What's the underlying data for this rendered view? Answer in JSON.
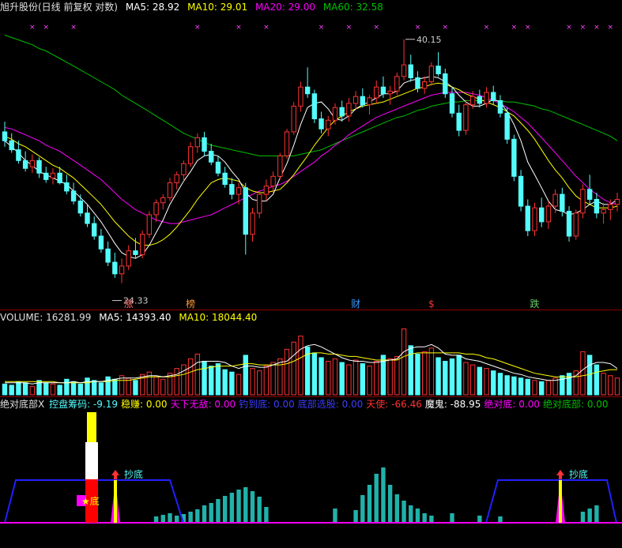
{
  "colors": {
    "up": "#ff3232",
    "down": "#54fcfc",
    "ma5": "#ffffff",
    "ma10": "#ffff00",
    "ma20": "#ff00ff",
    "ma60": "#00c000",
    "bg": "#000000"
  },
  "price_panel": {
    "title": "旭升股份(日线 前复权 对数)",
    "ma5": "MA5: 28.92",
    "ma10": "MA10: 29.01",
    "ma20": "MA20: 29.00",
    "ma60": "MA60: 32.58",
    "high_label": "40.15",
    "low_label": "24.33",
    "markers": [
      "涨",
      "榜",
      "财",
      "$",
      "跌"
    ]
  },
  "volume_panel": {
    "vol": "VOLUME: 16281.99",
    "ma5": "MA5: 14393.40",
    "ma10": "MA10: 18044.40"
  },
  "indicator_panel": {
    "name": "绝对底部X",
    "fields": [
      {
        "label": "控盘筹码:",
        "value": "-9.19",
        "color": "#54fcfc"
      },
      {
        "label": "稳赚:",
        "value": "0.00",
        "color": "#ffff00"
      },
      {
        "label": "天下无敌:",
        "value": "0.00",
        "color": "#ff00ff"
      },
      {
        "label": "钓到底:",
        "value": "0.00",
        "color": "#3c3cff"
      },
      {
        "label": "底部选股:",
        "value": "0.00",
        "color": "#3c3cff"
      },
      {
        "label": "天使:",
        "value": "-66.46",
        "color": "#ff3232"
      },
      {
        "label": "魔鬼:",
        "value": "-88.95",
        "color": "#ffffff"
      },
      {
        "label": "绝对底:",
        "value": "0.00",
        "color": "#ff00ff"
      },
      {
        "label": "绝对底部:",
        "value": "0.00",
        "color": "#00c000"
      }
    ],
    "signal_label": "抄底",
    "star_label": "★底"
  },
  "chart_data": {
    "type": "candlestick",
    "scale": "log",
    "ylim": [
      23.5,
      42.0
    ],
    "highlights": {
      "high": 40.15,
      "low": 24.33
    },
    "candles": [
      [
        33.2,
        33.9,
        32.2,
        32.6
      ],
      [
        32.6,
        33.1,
        31.8,
        32.0
      ],
      [
        32.0,
        32.6,
        31.1,
        31.3
      ],
      [
        31.3,
        31.9,
        30.6,
        30.8
      ],
      [
        30.9,
        31.7,
        30.5,
        31.3
      ],
      [
        31.3,
        31.5,
        30.2,
        30.5
      ],
      [
        30.5,
        30.9,
        29.9,
        30.1
      ],
      [
        30.2,
        30.8,
        29.8,
        30.5
      ],
      [
        30.5,
        30.9,
        29.8,
        29.9
      ],
      [
        29.9,
        30.4,
        29.2,
        29.4
      ],
      [
        29.4,
        29.9,
        28.6,
        28.8
      ],
      [
        28.8,
        29.2,
        27.9,
        28.1
      ],
      [
        28.1,
        28.6,
        27.3,
        27.5
      ],
      [
        27.5,
        27.9,
        26.6,
        26.8
      ],
      [
        26.8,
        27.2,
        25.9,
        26.1
      ],
      [
        26.1,
        26.5,
        25.2,
        25.4
      ],
      [
        25.4,
        25.9,
        24.6,
        24.8
      ],
      [
        24.8,
        25.6,
        24.33,
        25.2
      ],
      [
        25.2,
        26.3,
        25.0,
        26.0
      ],
      [
        26.0,
        26.7,
        25.6,
        25.8
      ],
      [
        25.8,
        27.1,
        25.6,
        26.9
      ],
      [
        26.9,
        28.2,
        26.7,
        28.0
      ],
      [
        28.0,
        28.9,
        27.6,
        28.7
      ],
      [
        28.7,
        29.2,
        28.3,
        29.0
      ],
      [
        29.0,
        30.2,
        28.8,
        29.9
      ],
      [
        29.9,
        30.6,
        29.5,
        30.4
      ],
      [
        30.4,
        31.3,
        30.0,
        31.1
      ],
      [
        31.1,
        32.5,
        30.9,
        32.2
      ],
      [
        32.2,
        33.1,
        31.8,
        32.8
      ],
      [
        32.8,
        33.2,
        31.6,
        31.9
      ],
      [
        31.9,
        32.4,
        31.0,
        31.2
      ],
      [
        31.2,
        31.6,
        30.3,
        30.5
      ],
      [
        30.5,
        30.9,
        29.6,
        29.8
      ],
      [
        29.8,
        30.2,
        28.9,
        29.2
      ],
      [
        29.2,
        29.9,
        28.6,
        29.6
      ],
      [
        29.6,
        29.9,
        25.8,
        26.9
      ],
      [
        26.9,
        28.4,
        26.5,
        28.1
      ],
      [
        28.1,
        29.4,
        27.8,
        29.2
      ],
      [
        29.2,
        30.1,
        28.8,
        29.7
      ],
      [
        29.7,
        30.6,
        29.3,
        30.3
      ],
      [
        30.3,
        31.8,
        30.1,
        31.6
      ],
      [
        31.6,
        33.4,
        31.4,
        33.2
      ],
      [
        33.2,
        35.3,
        33.0,
        35.0
      ],
      [
        35.0,
        36.8,
        34.6,
        36.4
      ],
      [
        36.4,
        37.9,
        35.6,
        35.9
      ],
      [
        35.9,
        36.2,
        33.8,
        34.1
      ],
      [
        34.1,
        34.6,
        33.1,
        33.4
      ],
      [
        33.4,
        34.3,
        32.9,
        34.0
      ],
      [
        34.0,
        35.2,
        33.7,
        34.9
      ],
      [
        34.9,
        35.4,
        33.9,
        34.3
      ],
      [
        34.3,
        35.6,
        33.9,
        35.2
      ],
      [
        35.2,
        36.1,
        34.8,
        35.7
      ],
      [
        35.7,
        36.3,
        34.9,
        35.1
      ],
      [
        35.1,
        35.8,
        34.4,
        35.6
      ],
      [
        35.6,
        36.9,
        35.2,
        36.4
      ],
      [
        36.4,
        37.2,
        35.6,
        35.9
      ],
      [
        35.9,
        36.5,
        35.1,
        36.1
      ],
      [
        36.1,
        37.5,
        35.8,
        37.2
      ],
      [
        37.2,
        40.15,
        36.9,
        38.1
      ],
      [
        38.1,
        38.9,
        36.8,
        37.1
      ],
      [
        37.1,
        37.6,
        36.0,
        36.3
      ],
      [
        36.3,
        37.2,
        35.9,
        36.8
      ],
      [
        36.8,
        38.3,
        36.5,
        38.0
      ],
      [
        38.0,
        39.1,
        37.2,
        37.4
      ],
      [
        37.4,
        37.8,
        35.6,
        35.9
      ],
      [
        35.9,
        36.4,
        34.2,
        34.5
      ],
      [
        34.5,
        35.1,
        32.9,
        33.3
      ],
      [
        33.3,
        35.4,
        33.0,
        35.1
      ],
      [
        35.1,
        36.1,
        34.8,
        35.7
      ],
      [
        35.7,
        36.2,
        34.9,
        35.2
      ],
      [
        35.2,
        36.4,
        34.9,
        36.0
      ],
      [
        36.0,
        36.5,
        35.1,
        35.4
      ],
      [
        35.4,
        35.8,
        34.2,
        34.5
      ],
      [
        34.5,
        34.9,
        32.4,
        32.7
      ],
      [
        32.7,
        33.0,
        30.0,
        30.3
      ],
      [
        30.3,
        30.7,
        28.2,
        28.5
      ],
      [
        28.5,
        28.9,
        26.8,
        27.1
      ],
      [
        27.1,
        28.7,
        26.8,
        28.4
      ],
      [
        28.4,
        29.0,
        27.3,
        27.6
      ],
      [
        27.6,
        28.8,
        27.2,
        28.5
      ],
      [
        28.5,
        29.5,
        28.1,
        29.2
      ],
      [
        29.2,
        29.6,
        27.9,
        28.2
      ],
      [
        28.2,
        28.5,
        26.5,
        26.8
      ],
      [
        26.8,
        28.3,
        26.6,
        28.1
      ],
      [
        28.1,
        29.8,
        27.8,
        29.5
      ],
      [
        29.5,
        30.4,
        28.6,
        28.9
      ],
      [
        28.9,
        29.3,
        27.8,
        28.1
      ],
      [
        28.1,
        28.7,
        27.5,
        28.3
      ],
      [
        28.3,
        28.9,
        27.7,
        28.6
      ],
      [
        28.6,
        29.3,
        28.2,
        28.9
      ]
    ],
    "ma5": [
      32.6,
      32.2,
      31.8,
      31.3,
      31.0,
      30.6,
      30.4,
      30.2,
      30.0,
      29.8,
      29.4,
      29.0,
      28.6,
      28.1,
      27.6,
      27.0,
      26.4,
      25.9,
      25.7,
      25.6,
      25.8,
      26.3,
      27.0,
      27.7,
      28.6,
      29.3,
      30.0,
      30.6,
      31.3,
      31.6,
      31.7,
      31.6,
      31.2,
      30.6,
      30.1,
      29.3,
      28.9,
      28.8,
      28.8,
      29.2,
      30.2,
      31.1,
      32.3,
      33.7,
      34.9,
      35.2,
      35.3,
      34.8,
      34.1,
      34.0,
      34.3,
      34.8,
      35.1,
      35.3,
      35.6,
      35.9,
      35.9,
      36.1,
      36.7,
      36.9,
      37.0,
      37.1,
      37.2,
      37.1,
      36.8,
      36.4,
      35.8,
      35.3,
      35.0,
      35.0,
      35.2,
      35.5,
      35.3,
      34.6,
      33.7,
      32.6,
      31.2,
      30.4,
      29.6,
      28.8,
      28.3,
      28.2,
      28.0,
      28.1,
      28.3,
      28.6,
      28.8,
      28.6,
      28.6,
      28.9
    ],
    "ma10": [
      32.9,
      32.7,
      32.4,
      32.2,
      31.9,
      31.6,
      31.3,
      31.0,
      30.8,
      30.5,
      30.2,
      29.8,
      29.4,
      29.0,
      28.6,
      28.1,
      27.6,
      27.2,
      26.8,
      26.5,
      26.3,
      26.3,
      26.4,
      26.6,
      26.9,
      27.3,
      27.8,
      28.3,
      28.9,
      29.4,
      29.9,
      30.1,
      30.2,
      30.1,
      30.0,
      29.6,
      29.4,
      29.3,
      29.3,
      29.4,
      29.5,
      29.9,
      30.4,
      31.0,
      31.6,
      32.3,
      32.9,
      33.5,
      34.0,
      34.3,
      34.6,
      34.8,
      35.0,
      35.1,
      35.2,
      35.3,
      35.5,
      35.7,
      35.9,
      36.1,
      36.3,
      36.4,
      36.6,
      36.7,
      36.6,
      36.4,
      36.2,
      35.9,
      35.7,
      35.5,
      35.3,
      35.1,
      34.9,
      34.6,
      34.3,
      33.8,
      33.3,
      32.7,
      32.0,
      31.3,
      30.7,
      30.2,
      29.6,
      29.1,
      28.8,
      28.6,
      28.4,
      28.4,
      28.4,
      28.5
    ],
    "ma20": [
      33.5,
      33.4,
      33.2,
      33.0,
      32.8,
      32.6,
      32.3,
      32.1,
      31.9,
      31.6,
      31.3,
      31.0,
      30.7,
      30.4,
      30.1,
      29.7,
      29.3,
      28.9,
      28.6,
      28.3,
      28.1,
      27.9,
      27.7,
      27.6,
      27.5,
      27.5,
      27.6,
      27.7,
      27.8,
      27.9,
      28.0,
      28.2,
      28.4,
      28.6,
      28.8,
      29.0,
      29.2,
      29.4,
      29.5,
      29.7,
      29.8,
      30.0,
      30.3,
      30.6,
      30.9,
      31.2,
      31.6,
      31.9,
      32.3,
      32.6,
      33.0,
      33.3,
      33.6,
      33.9,
      34.2,
      34.4,
      34.6,
      34.8,
      35.0,
      35.2,
      35.4,
      35.6,
      35.8,
      35.9,
      36.0,
      36.0,
      36.0,
      36.0,
      35.9,
      35.8,
      35.6,
      35.4,
      35.2,
      34.9,
      34.6,
      34.2,
      33.8,
      33.3,
      32.8,
      32.3,
      31.8,
      31.3,
      30.8,
      30.3,
      29.9,
      29.5,
      29.2,
      28.9,
      28.7,
      28.6
    ],
    "ma60": [
      40.5,
      40.3,
      40.1,
      39.9,
      39.7,
      39.4,
      39.2,
      38.9,
      38.6,
      38.3,
      38.0,
      37.7,
      37.4,
      37.1,
      36.8,
      36.5,
      36.2,
      35.8,
      35.5,
      35.2,
      34.9,
      34.6,
      34.3,
      34.0,
      33.7,
      33.4,
      33.1,
      32.9,
      32.7,
      32.5,
      32.3,
      32.2,
      32.1,
      32.0,
      31.9,
      31.8,
      31.7,
      31.6,
      31.6,
      31.6,
      31.6,
      31.6,
      31.6,
      31.7,
      31.8,
      31.9,
      32.0,
      32.2,
      32.4,
      32.6,
      32.8,
      33.0,
      33.2,
      33.4,
      33.6,
      33.8,
      34.0,
      34.2,
      34.3,
      34.5,
      34.7,
      34.8,
      35.0,
      35.1,
      35.2,
      35.3,
      35.3,
      35.4,
      35.4,
      35.4,
      35.4,
      35.4,
      35.4,
      35.3,
      35.3,
      35.2,
      35.1,
      35.0,
      34.8,
      34.7,
      34.5,
      34.3,
      34.1,
      33.9,
      33.7,
      33.5,
      33.3,
      33.1,
      32.9,
      32.6
    ],
    "volume": [
      9,
      8,
      11,
      10,
      7,
      12,
      10,
      9,
      8,
      13,
      11,
      9,
      14,
      12,
      10,
      15,
      13,
      16,
      14,
      12,
      17,
      19,
      15,
      13,
      18,
      22,
      25,
      30,
      34,
      28,
      24,
      26,
      21,
      19,
      17,
      33,
      22,
      20,
      24,
      27,
      30,
      38,
      44,
      49,
      40,
      35,
      31,
      28,
      30,
      27,
      25,
      29,
      26,
      24,
      28,
      33,
      30,
      32,
      55,
      41,
      34,
      36,
      39,
      31,
      28,
      30,
      33,
      27,
      25,
      23,
      22,
      20,
      18,
      16,
      15,
      14,
      13,
      12,
      11,
      12,
      14,
      16,
      18,
      20,
      36,
      33,
      25,
      18,
      16,
      14
    ],
    "vol_ma5": [
      10,
      10,
      10,
      10,
      9,
      10,
      10,
      10,
      10,
      10,
      11,
      10,
      11,
      11,
      11,
      12,
      13,
      14,
      14,
      14,
      15,
      16,
      16,
      15,
      16,
      17,
      20,
      23,
      27,
      28,
      28,
      28,
      27,
      24,
      22,
      24,
      24,
      23,
      23,
      25,
      27,
      28,
      33,
      38,
      41,
      42,
      40,
      37,
      34,
      31,
      29,
      28,
      28,
      27,
      27,
      28,
      29,
      30,
      36,
      39,
      40,
      40,
      42,
      39,
      34,
      33,
      33,
      30,
      29,
      28,
      26,
      24,
      22,
      20,
      18,
      17,
      15,
      14,
      13,
      12,
      12,
      13,
      14,
      16,
      21,
      25,
      27,
      27,
      26,
      22
    ],
    "vol_ma10": [
      11,
      11,
      11,
      11,
      11,
      11,
      11,
      11,
      10,
      10,
      10,
      10,
      10,
      11,
      11,
      11,
      12,
      12,
      12,
      13,
      14,
      15,
      15,
      15,
      15,
      16,
      17,
      19,
      21,
      22,
      23,
      24,
      24,
      24,
      25,
      26,
      26,
      25,
      25,
      25,
      25,
      26,
      28,
      31,
      34,
      35,
      35,
      34,
      34,
      33,
      32,
      32,
      31,
      30,
      29,
      29,
      29,
      29,
      32,
      34,
      35,
      35,
      35,
      35,
      35,
      35,
      35,
      34,
      34,
      33,
      31,
      30,
      28,
      26,
      24,
      22,
      20,
      18,
      17,
      16,
      15,
      15,
      15,
      15,
      16,
      17,
      19,
      20,
      21,
      21
    ],
    "signal_bars": [
      0,
      0,
      0,
      0,
      0,
      0,
      0,
      0,
      0,
      0,
      0,
      0,
      0,
      0,
      0,
      0,
      0,
      0,
      0,
      0,
      0,
      0,
      8,
      10,
      12,
      9,
      11,
      14,
      17,
      22,
      25,
      30,
      34,
      38,
      42,
      45,
      40,
      33,
      20,
      0,
      0,
      0,
      0,
      0,
      0,
      0,
      0,
      0,
      18,
      0,
      0,
      16,
      35,
      48,
      62,
      70,
      48,
      36,
      28,
      22,
      18,
      12,
      9,
      0,
      0,
      12,
      0,
      0,
      0,
      9,
      0,
      0,
      8,
      0,
      0,
      0,
      0,
      0,
      0,
      0,
      0,
      9,
      0,
      0,
      14,
      18,
      22,
      0,
      0,
      0
    ]
  }
}
